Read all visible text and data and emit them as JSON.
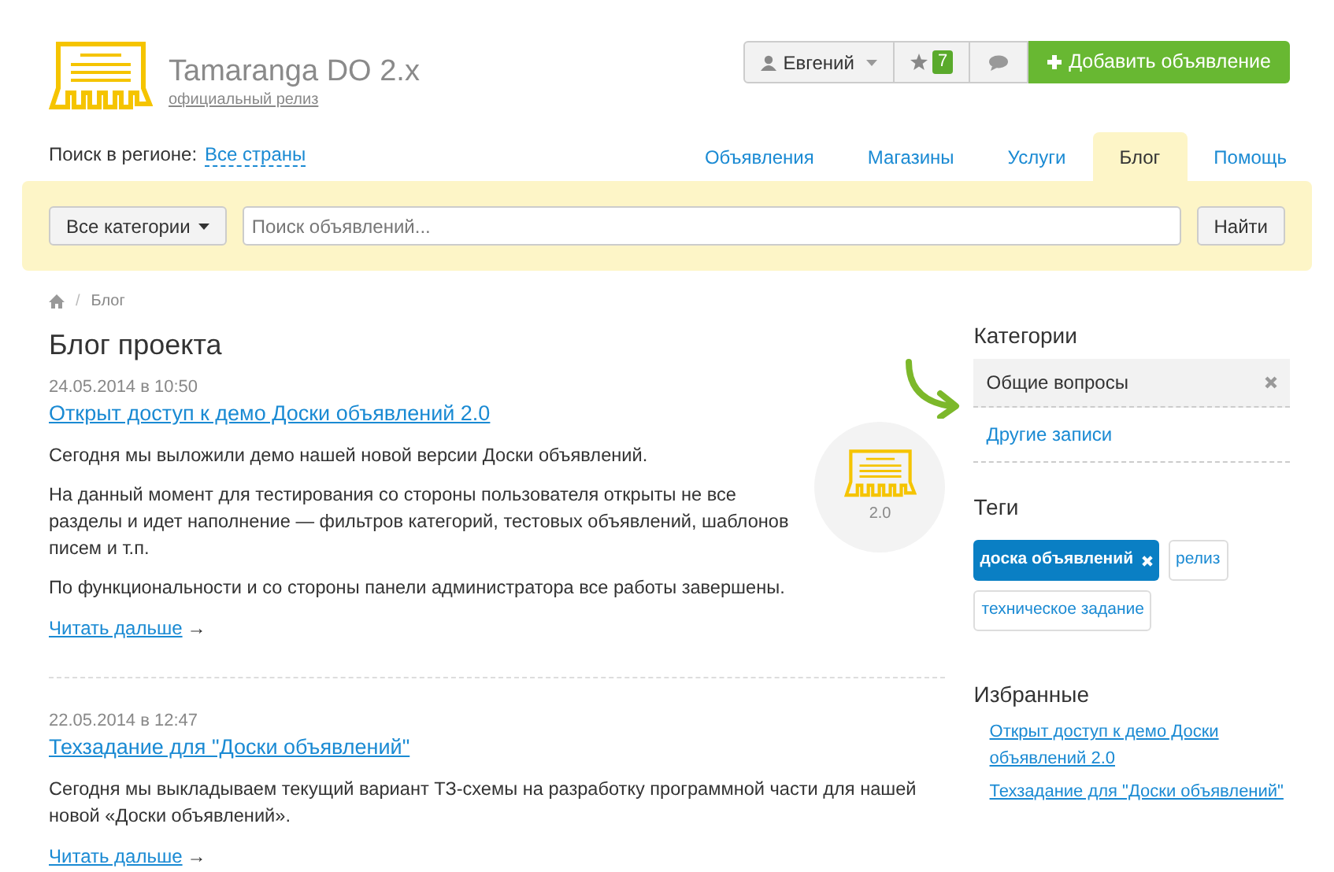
{
  "logo": {
    "title": "Tamaranga DO 2.x",
    "subtitle": "официальный релиз"
  },
  "user_menu": {
    "user": "Евгений",
    "favorites_count": "7",
    "add_button": "Добавить объявление"
  },
  "region": {
    "label": "Поиск в регионе:",
    "value": "Все страны"
  },
  "nav": [
    {
      "label": "Объявления",
      "selected": false
    },
    {
      "label": "Магазины",
      "selected": false
    },
    {
      "label": "Услуги",
      "selected": false
    },
    {
      "label": "Блог",
      "selected": true
    },
    {
      "label": "Помощь",
      "selected": false
    }
  ],
  "search": {
    "category_button": "Все категории",
    "placeholder": "Поиск объявлений...",
    "submit": "Найти"
  },
  "breadcrumb": {
    "separator": "/",
    "current": "Блог"
  },
  "blog": {
    "title": "Блог проекта",
    "posts": [
      {
        "date": "24.05.2014 в 10:50",
        "title": "Открыт доступ к демо Доски объявлений 2.0",
        "paragraphs": [
          "Сегодня мы выложили демо нашей новой версии Доски объявлений.",
          "На данный момент для тестирования со стороны пользователя открыты не все разделы и идет наполнение — фильтров категорий, тестовых объявлений, шаблонов писем и т.п.",
          "По функциональности и со стороны панели администратора все работы завершены."
        ],
        "read_more": "Читать дальше",
        "arrow": "→",
        "badge": "2.0"
      },
      {
        "date": "22.05.2014 в 12:47",
        "title": "Техзадание для \"Доски объявлений\"",
        "paragraphs": [
          "Сегодня мы выкладываем текущий вариант ТЗ-схемы на разработку программной части для нашей новой «Доски объявлений»."
        ],
        "read_more": "Читать дальше",
        "arrow": "→"
      }
    ]
  },
  "sidebar": {
    "categories": {
      "title": "Категории",
      "items": [
        {
          "label": "Общие вопросы",
          "selected": true
        },
        {
          "label": "Другие записи",
          "selected": false
        }
      ]
    },
    "tags": {
      "title": "Теги",
      "items": [
        {
          "label": "доска объявлений",
          "selected": true
        },
        {
          "label": "релиз",
          "selected": false
        },
        {
          "label": "техническое задание",
          "selected": false
        }
      ]
    },
    "favorites": {
      "title": "Избранные",
      "links": [
        "Открыт доступ к демо Доски объявлений 2.0",
        "Техзадание для \"Доски объявлений\""
      ]
    }
  }
}
